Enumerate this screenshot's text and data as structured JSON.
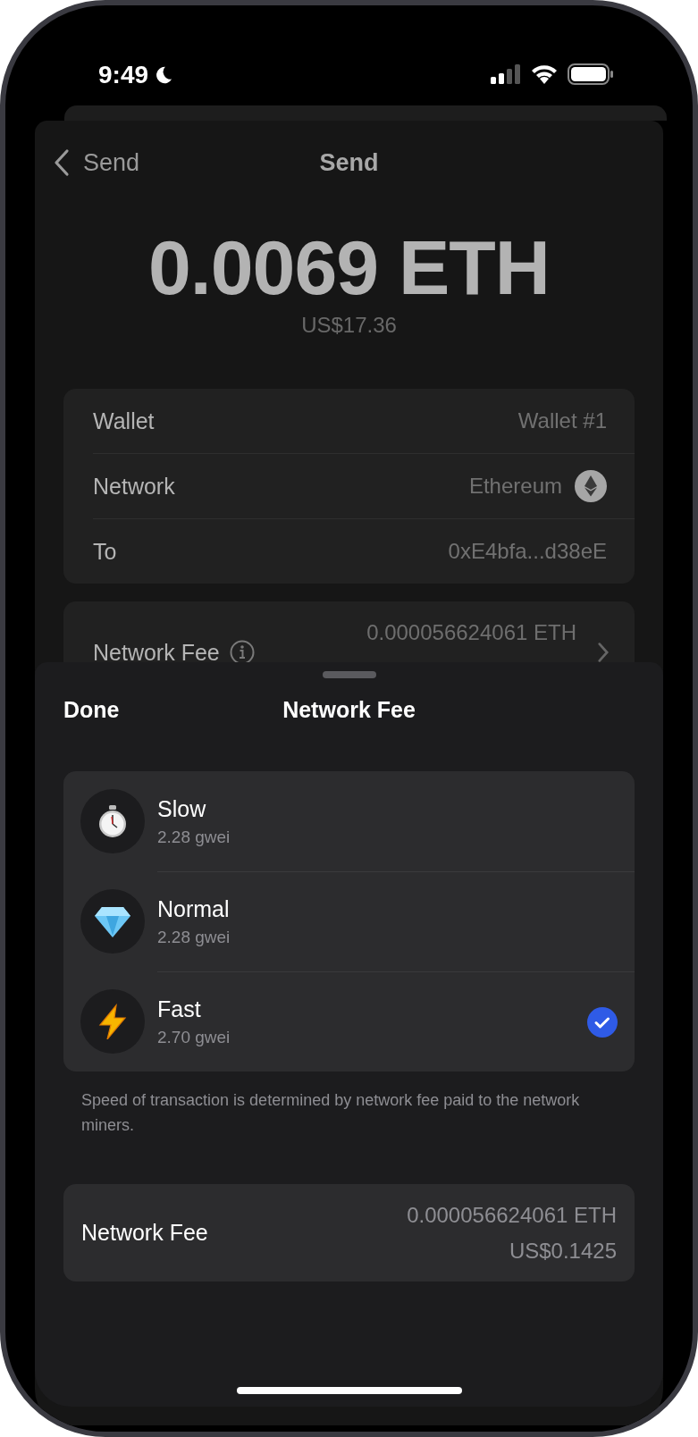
{
  "status_bar": {
    "time": "9:49"
  },
  "nav": {
    "back_label": "Send",
    "title": "Send"
  },
  "amount": {
    "value": "0.0069 ETH",
    "fiat": "US$17.36"
  },
  "details": [
    {
      "label": "Wallet",
      "value": "Wallet #1",
      "kind": "plain"
    },
    {
      "label": "Network",
      "value": "Ethereum",
      "kind": "network"
    },
    {
      "label": "To",
      "value": "0xE4bfa...d38eE",
      "kind": "plain"
    }
  ],
  "fee_summary": {
    "label": "Network Fee",
    "amount": "0.000056624061 ETH"
  },
  "sheet": {
    "done": "Done",
    "title": "Network Fee",
    "options": [
      {
        "name": "Slow",
        "rate": "2.28 gwei",
        "kind": "stopwatch",
        "selected": false
      },
      {
        "name": "Normal",
        "rate": "2.28 gwei",
        "kind": "diamond",
        "selected": false
      },
      {
        "name": "Fast",
        "rate": "2.70 gwei",
        "kind": "lightning",
        "selected": true
      }
    ],
    "note": "Speed of transaction is determined by network fee paid to the network miners.",
    "fee": {
      "label": "Network Fee",
      "amount": "0.000056624061 ETH",
      "fiat": "US$0.1425"
    }
  }
}
